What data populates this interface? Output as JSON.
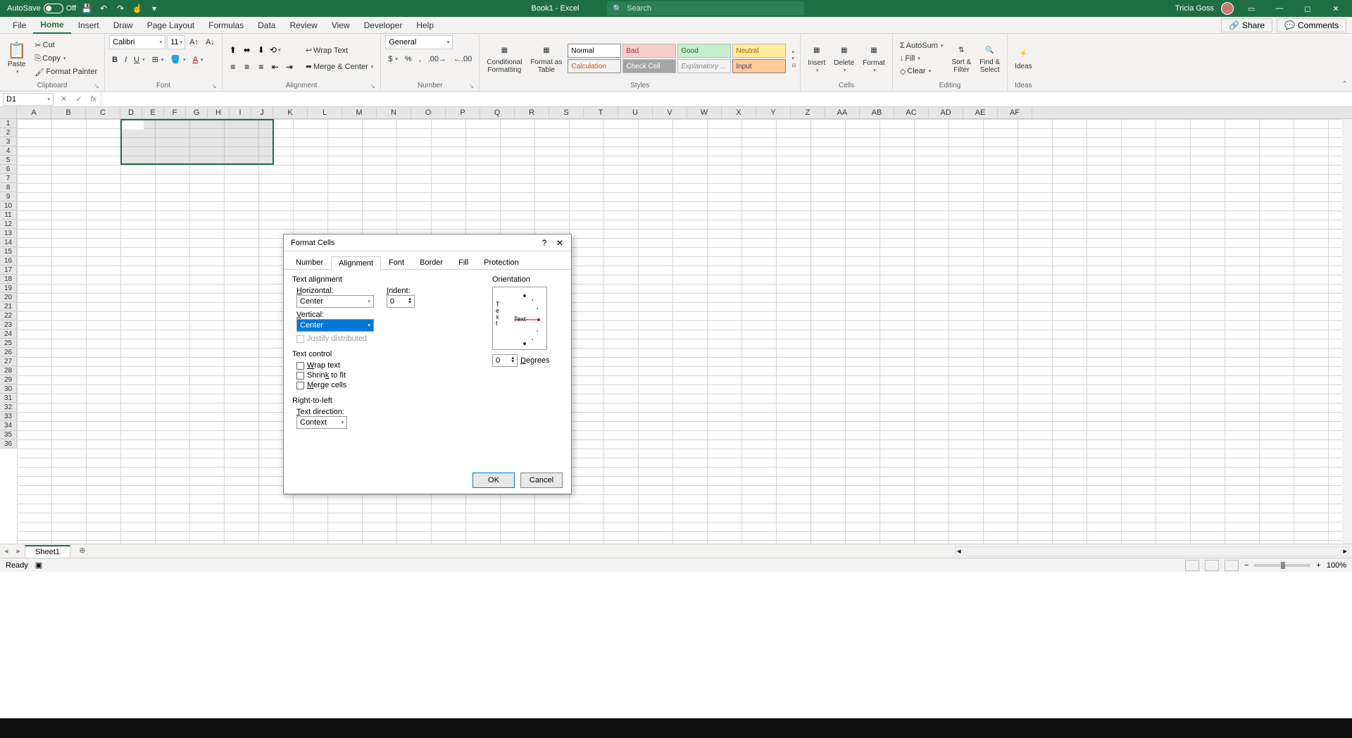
{
  "title": {
    "autosave": "AutoSave",
    "autosave_state": "Off",
    "doc": "Book1 - Excel",
    "search": "Search",
    "user": "Tricia Goss"
  },
  "menu": {
    "file": "File",
    "home": "Home",
    "insert": "Insert",
    "draw": "Draw",
    "page": "Page Layout",
    "formulas": "Formulas",
    "data": "Data",
    "review": "Review",
    "view": "View",
    "dev": "Developer",
    "help": "Help",
    "share": "Share",
    "comments": "Comments"
  },
  "ribbon": {
    "clipboard": {
      "paste": "Paste",
      "cut": "Cut",
      "copy": "Copy",
      "fmtpaint": "Format Painter",
      "label": "Clipboard"
    },
    "font": {
      "name": "Calibri",
      "size": "11",
      "label": "Font"
    },
    "alignment": {
      "wrap": "Wrap Text",
      "merge": "Merge & Center",
      "label": "Alignment"
    },
    "number": {
      "fmt": "General",
      "label": "Number"
    },
    "styles": {
      "cond": "Conditional\nFormatting",
      "table": "Format as\nTable",
      "normal": "Normal",
      "bad": "Bad",
      "good": "Good",
      "neutral": "Neutral",
      "calc": "Calculation",
      "check": "Check Cell",
      "expl": "Explanatory ...",
      "input": "Input",
      "label": "Styles"
    },
    "cells": {
      "insert": "Insert",
      "delete": "Delete",
      "format": "Format",
      "label": "Cells"
    },
    "editing": {
      "autosum": "AutoSum",
      "fill": "Fill",
      "clear": "Clear",
      "sort": "Sort &\nFilter",
      "find": "Find &\nSelect",
      "label": "Editing"
    },
    "ideas": {
      "ideas": "Ideas",
      "label": "Ideas"
    }
  },
  "namebox": "D1",
  "columns": [
    "A",
    "B",
    "C",
    "D",
    "E",
    "F",
    "G",
    "H",
    "I",
    "J",
    "K",
    "L",
    "M",
    "N",
    "O",
    "P",
    "Q",
    "R",
    "S",
    "T",
    "U",
    "V",
    "W",
    "X",
    "Y",
    "Z",
    "AA",
    "AB",
    "AC",
    "AD",
    "AE",
    "AF"
  ],
  "rows": [
    "1",
    "2",
    "3",
    "4",
    "5",
    "6",
    "7",
    "8",
    "9",
    "10",
    "11",
    "12",
    "13",
    "14",
    "15",
    "16",
    "17",
    "18",
    "19",
    "20",
    "21",
    "22",
    "23",
    "24",
    "25",
    "26",
    "27",
    "28",
    "29",
    "30",
    "31",
    "32",
    "33",
    "34",
    "35",
    "36"
  ],
  "dialog": {
    "title": "Format Cells",
    "tabs": {
      "number": "Number",
      "alignment": "Alignment",
      "font": "Font",
      "border": "Border",
      "fill": "Fill",
      "protection": "Protection"
    },
    "textalign": "Text alignment",
    "horiz_lbl": "Horizontal:",
    "horiz_val": "Center",
    "indent_lbl": "Indent:",
    "indent_val": "0",
    "vert_lbl": "Vertical:",
    "vert_val": "Center",
    "justify": "Justify distributed",
    "textctrl": "Text control",
    "wrap": "Wrap text",
    "shrink": "Shrink to fit",
    "merge": "Merge cells",
    "rtl": "Right-to-left",
    "textdir_lbl": "Text direction:",
    "textdir_val": "Context",
    "orient": "Orientation",
    "orient_text": "Text",
    "deg_val": "0",
    "deg_lbl": "Degrees",
    "ok": "OK",
    "cancel": "Cancel"
  },
  "sheet": {
    "name": "Sheet1"
  },
  "status": {
    "ready": "Ready",
    "zoom": "100%"
  }
}
